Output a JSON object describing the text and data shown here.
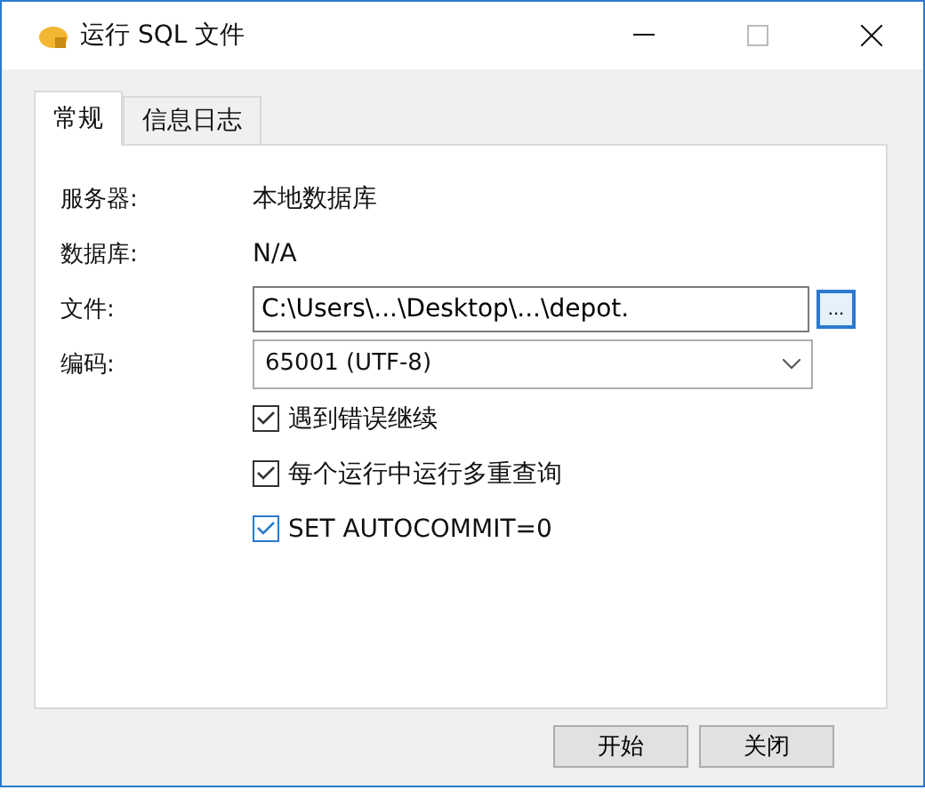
{
  "window": {
    "title": "运行 SQL 文件"
  },
  "tabs": [
    {
      "label": "常规",
      "selected": true
    },
    {
      "label": "信息日志",
      "selected": false
    }
  ],
  "fields": [
    {
      "kind": "text",
      "label": "服务器:",
      "value": "本地数据库"
    },
    {
      "kind": "text",
      "label": "数据库:",
      "value": "N/A"
    },
    {
      "kind": "file",
      "label": "文件:",
      "value": "C:\\Users\\...\\Desktop\\...\\depot.",
      "button": "..."
    },
    {
      "kind": "select",
      "label": "编码:",
      "value": "65001 (UTF-8)"
    }
  ],
  "options": [
    {
      "label": "遇到错误继续",
      "checked": true,
      "focused": false
    },
    {
      "label": "每个运行中运行多重查询",
      "checked": true,
      "focused": false
    },
    {
      "label": "SET AUTOCOMMIT=0",
      "checked": true,
      "focused": true
    }
  ],
  "buttons": [
    "开始",
    "关闭"
  ]
}
